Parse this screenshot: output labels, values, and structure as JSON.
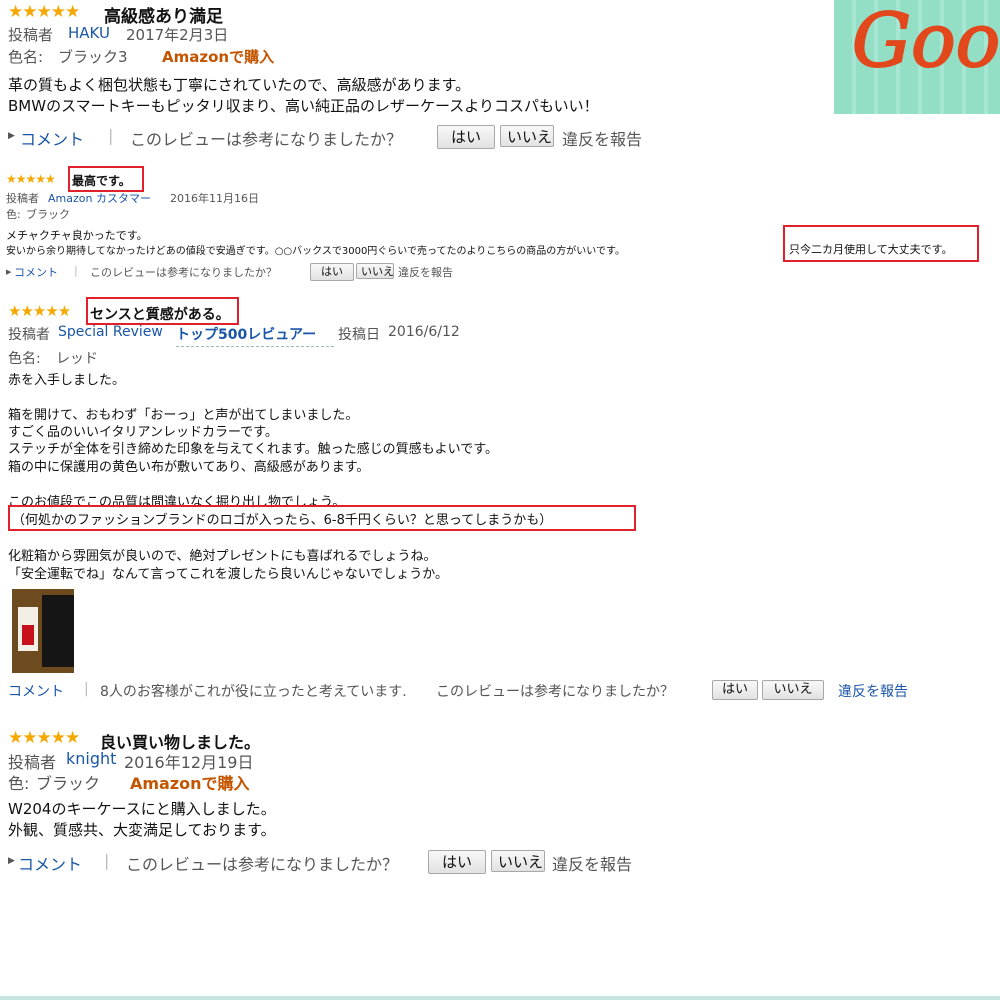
{
  "stars": "★★★★★",
  "common": {
    "comment": "コメント",
    "helpful_q": "このレビューは参考になりましたか？",
    "yes": "はい",
    "no": "いいえ",
    "report": "違反を報告",
    "posted_by": "投稿者",
    "color_label": "色名:",
    "color_label2": "色:",
    "buy": "Amazonで購入"
  },
  "badge": {
    "text": "Good"
  },
  "review1": {
    "title": "高級感あり満足",
    "author": "HAKU",
    "date": "2017年2月3日",
    "color": "ブラック3",
    "lines": [
      "革の質もよく梱包状態も丁寧にされていたので、高級感があります。",
      "BMWのスマートキーもピッタリ収まり、高い純正品のレザーケースよりコスパもいい！"
    ]
  },
  "review2": {
    "title": "最高です。",
    "author": "Amazon カスタマー",
    "date": "2016年11月16日",
    "color": "ブラック",
    "line1": "メチャクチャ良かったです。",
    "line2": "安いから余り期待してなかったけどあの値段で安過ぎです。○○バックスで3000円ぐらいで売ってたのよりこちらの商品の方がいいです。",
    "highlight": "只今二カ月使用して大丈夫です。"
  },
  "review3": {
    "title": "センスと質感がある。",
    "author": "Special Review",
    "rank": "トップ500レビュアー",
    "date_label": "投稿日",
    "date": "2016/6/12",
    "color": "レッド",
    "lines": [
      "赤を入手しました。",
      "",
      "箱を開けて、おもわず「おーっ」と声が出てしまいました。",
      "すごく品のいいイタリアンレッドカラーです。",
      "ステッチが全体を引き締めた印象を与えてくれます。触った感じの質感もよいです。",
      "箱の中に保護用の黄色い布が敷いてあり、高級感があります。",
      "",
      "このお値段でこの品質は間違いなく掘り出し物でしょう。"
    ],
    "highlight": "（何処かのファッションブランドのロゴが入ったら、6-8千円くらい？と思ってしまうかも）",
    "lines2": [
      "化粧箱から雰囲気が良いので、絶対プレゼントにも喜ばれるでしょうね。",
      "「安全運転でね」なんて言ってこれを渡したら良いんじゃないでしょうか。"
    ],
    "helpful_count": "8人のお客様がこれが役に立ったと考えています.",
    "no": "いいえ"
  },
  "review4": {
    "title": "良い買い物しました。",
    "author": "knight",
    "date": "2016年12月19日",
    "color": "ブラック",
    "lines": [
      "W204のキーケースにと購入しました。",
      "外観、質感共、大変満足しております。"
    ]
  }
}
